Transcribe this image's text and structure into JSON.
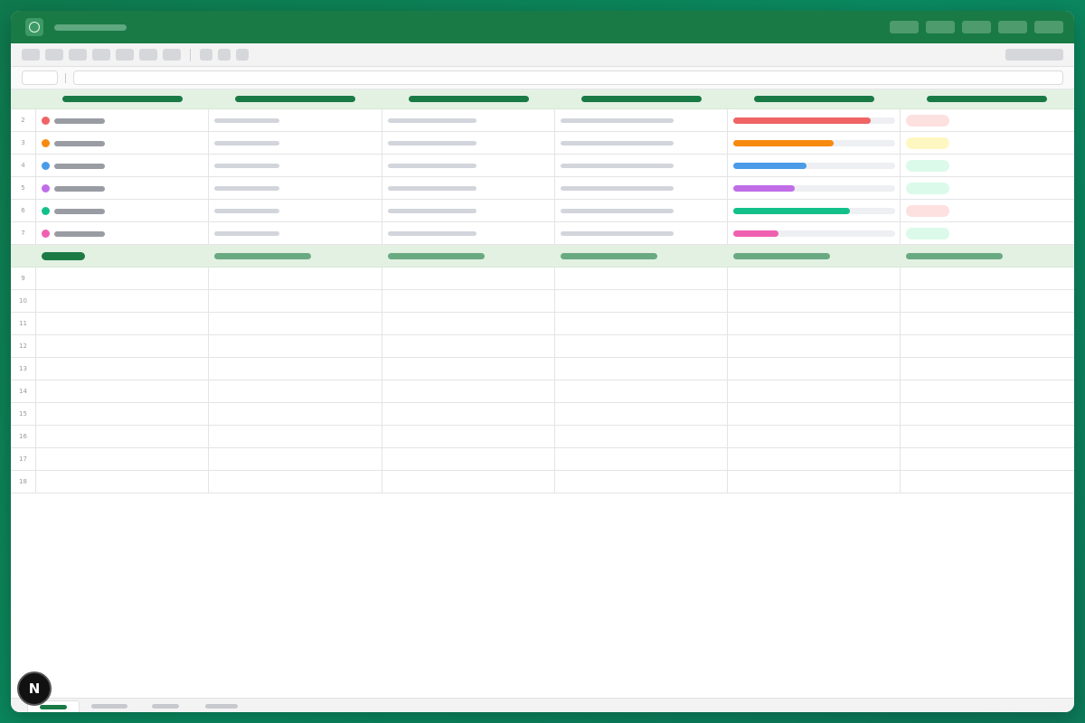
{
  "colors": {
    "brand": "#197a45",
    "header_bg": "#e3f1e3",
    "placeholder": "#d3d5dc"
  },
  "titlebar": {
    "icon": "app-circle-icon",
    "window_buttons": 5
  },
  "toolbar": {
    "groups": [
      7,
      3
    ]
  },
  "rows": [
    {
      "num": "2",
      "dot_color": "#f06464",
      "progress": 0.85,
      "progress_color": "#f06464",
      "status_color": "#fde0e0"
    },
    {
      "num": "3",
      "dot_color": "#f78a10",
      "progress": 0.62,
      "progress_color": "#f78a10",
      "status_color": "#fff7c2"
    },
    {
      "num": "4",
      "dot_color": "#4a9be8",
      "progress": 0.45,
      "progress_color": "#4a9be8",
      "status_color": "#dcfaea"
    },
    {
      "num": "5",
      "dot_color": "#c06ee8",
      "progress": 0.38,
      "progress_color": "#c06ee8",
      "status_color": "#dcfaea"
    },
    {
      "num": "6",
      "dot_color": "#14c08a",
      "progress": 0.72,
      "progress_color": "#14c08a",
      "status_color": "#fde0e0"
    },
    {
      "num": "7",
      "dot_color": "#f060b0",
      "progress": 0.28,
      "progress_color": "#f060b0",
      "status_color": "#dcfaea"
    }
  ],
  "empty_rows": [
    "9",
    "10",
    "11",
    "12",
    "13",
    "14",
    "15",
    "16",
    "17",
    "18"
  ],
  "badge": {
    "letter": "N"
  }
}
